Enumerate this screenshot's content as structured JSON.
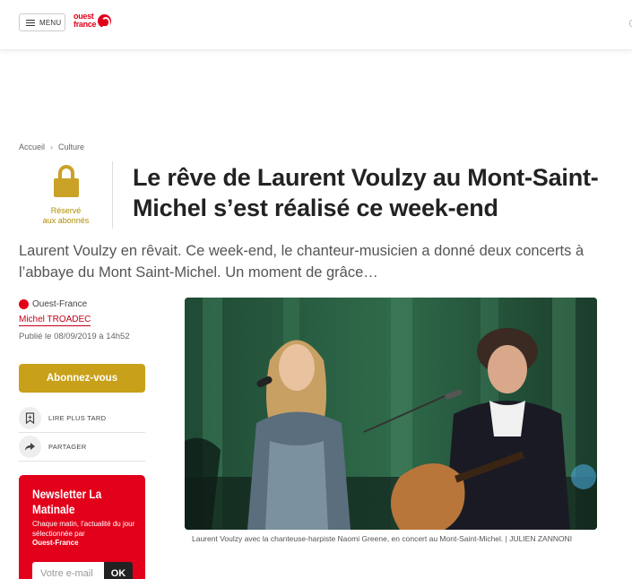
{
  "header": {
    "menu_label": "MENU",
    "logo_line1": "ouest",
    "logo_line2": "france"
  },
  "breadcrumb": [
    "Accueil",
    "Culture"
  ],
  "access": {
    "label_line1": "Réservé",
    "label_line2": "aux abonnés"
  },
  "article": {
    "title": "Le rêve de Laurent Voulzy au Mont-Saint-Michel s’est réalisé ce week-end",
    "lead": "Laurent Voulzy en rêvait. Ce week-end, le chanteur-musicien a donné deux concerts à l’abbaye du Mont Saint-Michel. Un moment de grâce…",
    "source": "Ouest-France",
    "author": "Michel TROADEC",
    "published": "Publié le 08/09/2019 à 14h52",
    "photo_caption": "Laurent Voulzy avec la chanteuse-harpiste Naomi Greene, en concert au Mont-Saint-Michel. | JULIEN ZANNONI"
  },
  "sidebar": {
    "subscribe_label": "Abonnez-vous",
    "read_later_label": "LIRE PLUS TARD",
    "share_label": "PARTAGER"
  },
  "newsletter": {
    "title": "Newsletter La Matinale",
    "desc": "Chaque matin, l’actualité du jour sélectionnée par",
    "desc_brand": "Ouest-France",
    "email_placeholder": "Votre e-mail",
    "ok_label": "OK"
  },
  "colors": {
    "brand_red": "#e2001a",
    "gold": "#c9a01a"
  }
}
